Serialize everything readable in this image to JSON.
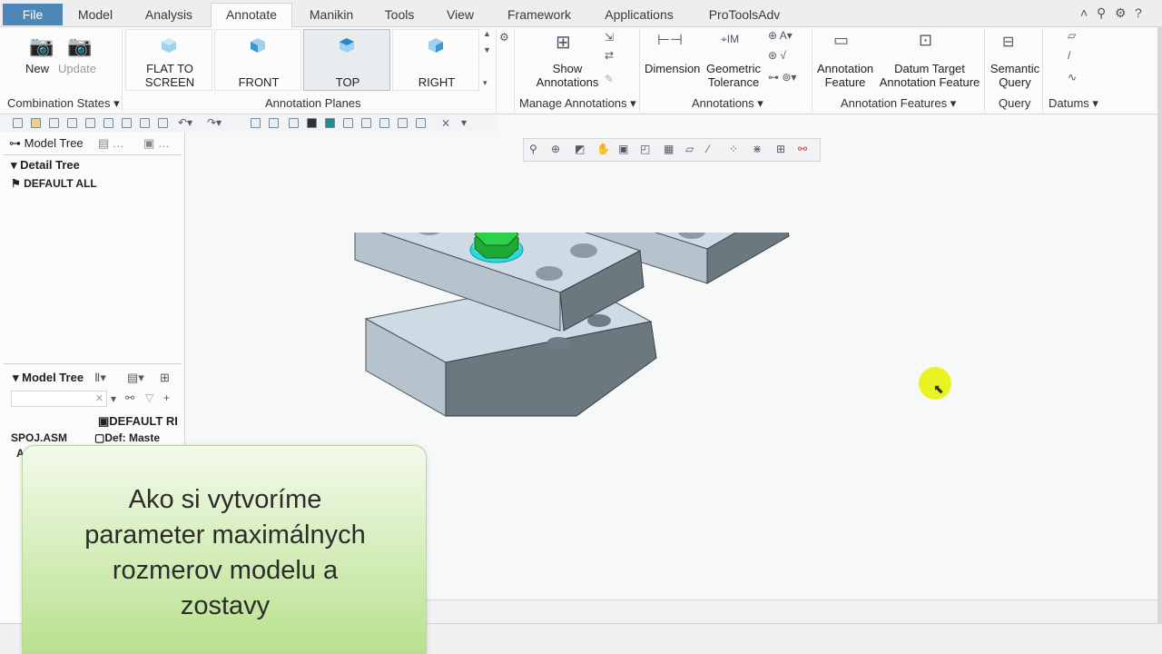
{
  "menu": {
    "file": "File",
    "tabs": [
      "Model",
      "Analysis",
      "Annotate",
      "Manikin",
      "Tools",
      "View",
      "Framework",
      "Applications",
      "ProToolsAdv"
    ],
    "active": "Annotate"
  },
  "ribbon": {
    "new_label": "New",
    "update_label": "Update",
    "combination_states": "Combination States",
    "planes": [
      "FLAT TO SCREEN",
      "FRONT",
      "TOP",
      "RIGHT"
    ],
    "annotation_planes": "Annotation Planes",
    "show_annotations": "Show Annotations",
    "manage_annotations": "Manage Annotations",
    "dimension": "Dimension",
    "geometric_tolerance": "Geometric Tolerance",
    "annotations_group": "Annotations",
    "annotation_feature": "Annotation Feature",
    "datum_target": "Datum Target Annotation Feature",
    "annotation_features_group": "Annotation Features",
    "semantic_query": "Semantic Query",
    "query_group": "Query",
    "datums_group": "Datums"
  },
  "left_panel": {
    "tab_model_tree": "Model Tree",
    "detail_tree": "Detail Tree",
    "default_all": "DEFAULT ALL",
    "model_tree_header": "Model Tree",
    "col_default": "DEFAULT RI",
    "row_name": "SPOJ.ASM",
    "row_def": "Def: Maste",
    "partial": "An"
  },
  "caption": {
    "line1": "Ako si vytvoríme",
    "line2": "parameter maximálnych",
    "line3": "rozmerov modelu a",
    "line4": "zostavy"
  },
  "colors": {
    "file_tab": "#4f86b8",
    "plate_top": "#cfdbe4",
    "plate_side": "#6b7880",
    "bolt": "#22c13c",
    "caption_green": "#b9e18f",
    "cursor": "#e6f20a"
  }
}
